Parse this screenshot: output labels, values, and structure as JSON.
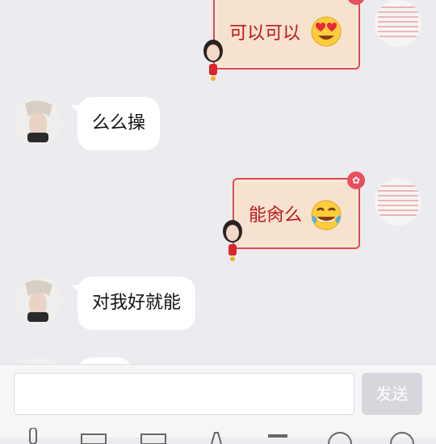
{
  "messages": [
    {
      "side": "self",
      "text": "可以可以",
      "emoji": "heart-eyes-emoji"
    },
    {
      "side": "peer",
      "text": "么么操"
    },
    {
      "side": "self",
      "text": "能肏么",
      "emoji": "tears-of-joy-emoji"
    },
    {
      "side": "peer",
      "text": "对我好就能"
    }
  ],
  "input": {
    "value": "",
    "placeholder": ""
  },
  "send_label": "发送",
  "toolbar": {
    "icons": [
      "mic-icon",
      "picture-icon",
      "camera-icon",
      "red-packet-icon",
      "gift-icon",
      "emoji-icon",
      "more-icon"
    ]
  },
  "colors": {
    "background": "#ebebf0",
    "peer_bubble": "#ffffff",
    "theme_border": "#e24a4a",
    "theme_fill": "#f6e2cf",
    "theme_text": "#c0161d",
    "send_disabled": "#d6d6dc"
  }
}
